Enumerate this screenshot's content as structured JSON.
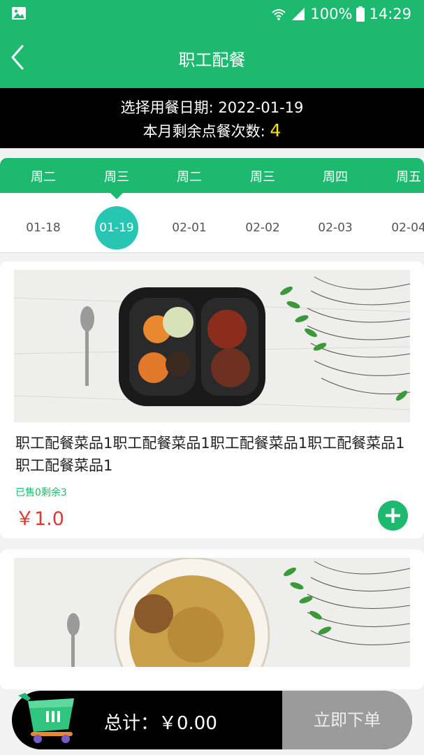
{
  "status_bar": {
    "battery": "100%",
    "time": "14:29"
  },
  "app_bar": {
    "title": "职工配餐"
  },
  "info": {
    "date_label": "选择用餐日期: 2022-01-19",
    "remaining_label": "本月剩余点餐次数: ",
    "remaining_count": "4"
  },
  "calendar": {
    "weekdays": [
      "周二",
      "周三",
      "周二",
      "周三",
      "周四",
      "周五"
    ],
    "dates": [
      "01-18",
      "01-19",
      "02-01",
      "02-02",
      "02-03",
      "02-04"
    ],
    "selected_index": 1
  },
  "items": [
    {
      "name": "职工配餐菜品1职工配餐菜品1职工配餐菜品1职工配餐菜品1职工配餐菜品1",
      "sold_info": "已售0剩余3",
      "price": "￥1.0"
    }
  ],
  "cart": {
    "total_label": "总计：￥0.00",
    "order_button": "立即下单"
  },
  "colors": {
    "primary": "#1db96f",
    "selected_date": "#26c6b3",
    "price": "#e0382b",
    "count": "#f7e21b"
  }
}
